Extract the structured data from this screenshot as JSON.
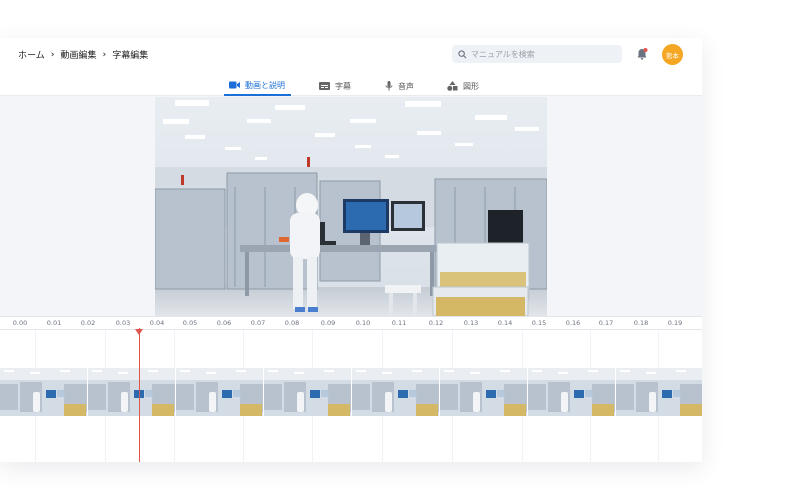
{
  "breadcrumb": {
    "items": [
      "ホーム",
      "動画編集",
      "字幕編集"
    ]
  },
  "search": {
    "placeholder": "マニュアルを検索"
  },
  "user": {
    "avatar_text": "熊本",
    "avatar_color": "#f5a623"
  },
  "tabs": [
    {
      "label": "動画と説明",
      "icon": "video-icon",
      "active": true
    },
    {
      "label": "字幕",
      "icon": "subtitles-icon",
      "active": false
    },
    {
      "label": "音声",
      "icon": "microphone-icon",
      "active": false
    },
    {
      "label": "図形",
      "icon": "shapes-icon",
      "active": false
    }
  ],
  "accent_color": "#1b6fd6",
  "playhead_color": "#e0554c",
  "timeline": {
    "ticks": [
      "0.00",
      "0.01",
      "0.02",
      "0.03",
      "0.04",
      "0.05",
      "0.06",
      "0.07",
      "0.08",
      "0.09",
      "0.10",
      "0.11",
      "0.12",
      "0.13",
      "0.14",
      "0.15",
      "0.16",
      "0.17",
      "0.18",
      "0.19"
    ],
    "playhead_time": 0.035
  }
}
